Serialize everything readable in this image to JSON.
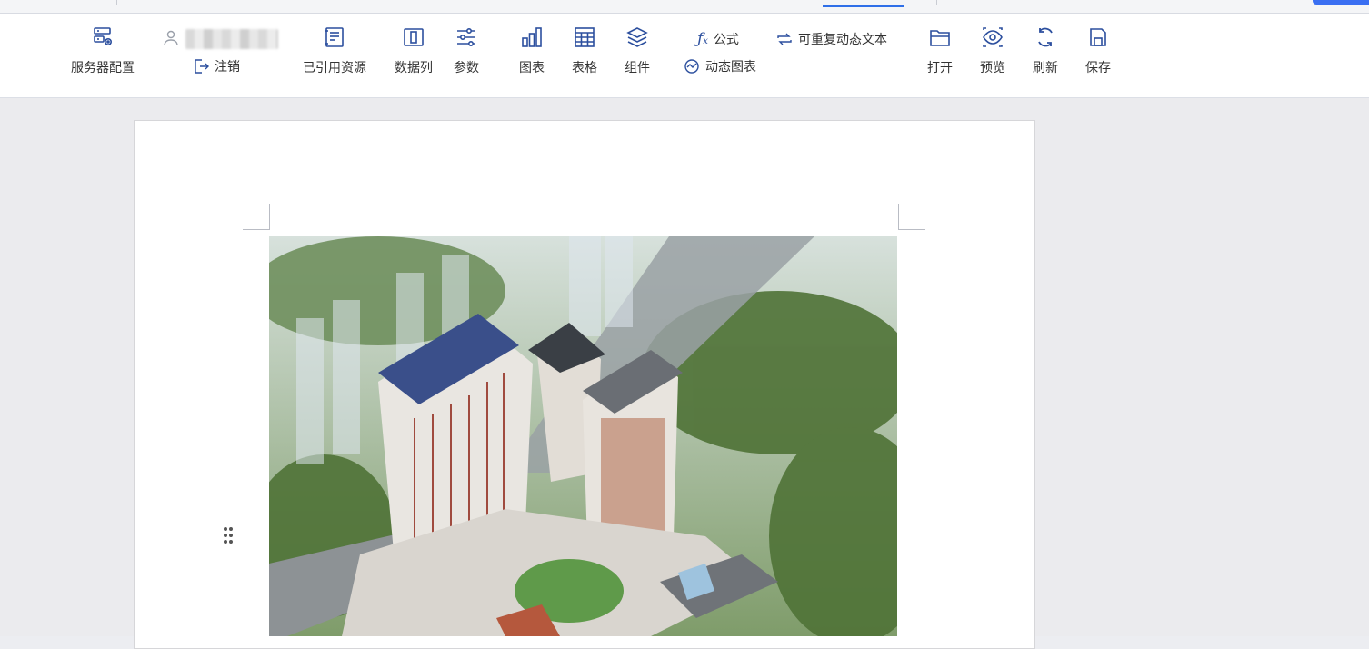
{
  "toolbar": {
    "server_config": "服务器配置",
    "logout": "注销",
    "referenced_resources": "已引用资源",
    "data_columns": "数据列",
    "parameters": "参数",
    "chart": "图表",
    "table": "表格",
    "component": "组件",
    "formula": "公式",
    "dynamic_chart": "动态图表",
    "repeatable_text": "可重复动态文本",
    "open": "打开",
    "preview": "预览",
    "refresh": "刷新",
    "save": "保存"
  },
  "colors": {
    "icon_blue": "#2c4f9e",
    "accent": "#3a6ff2"
  }
}
